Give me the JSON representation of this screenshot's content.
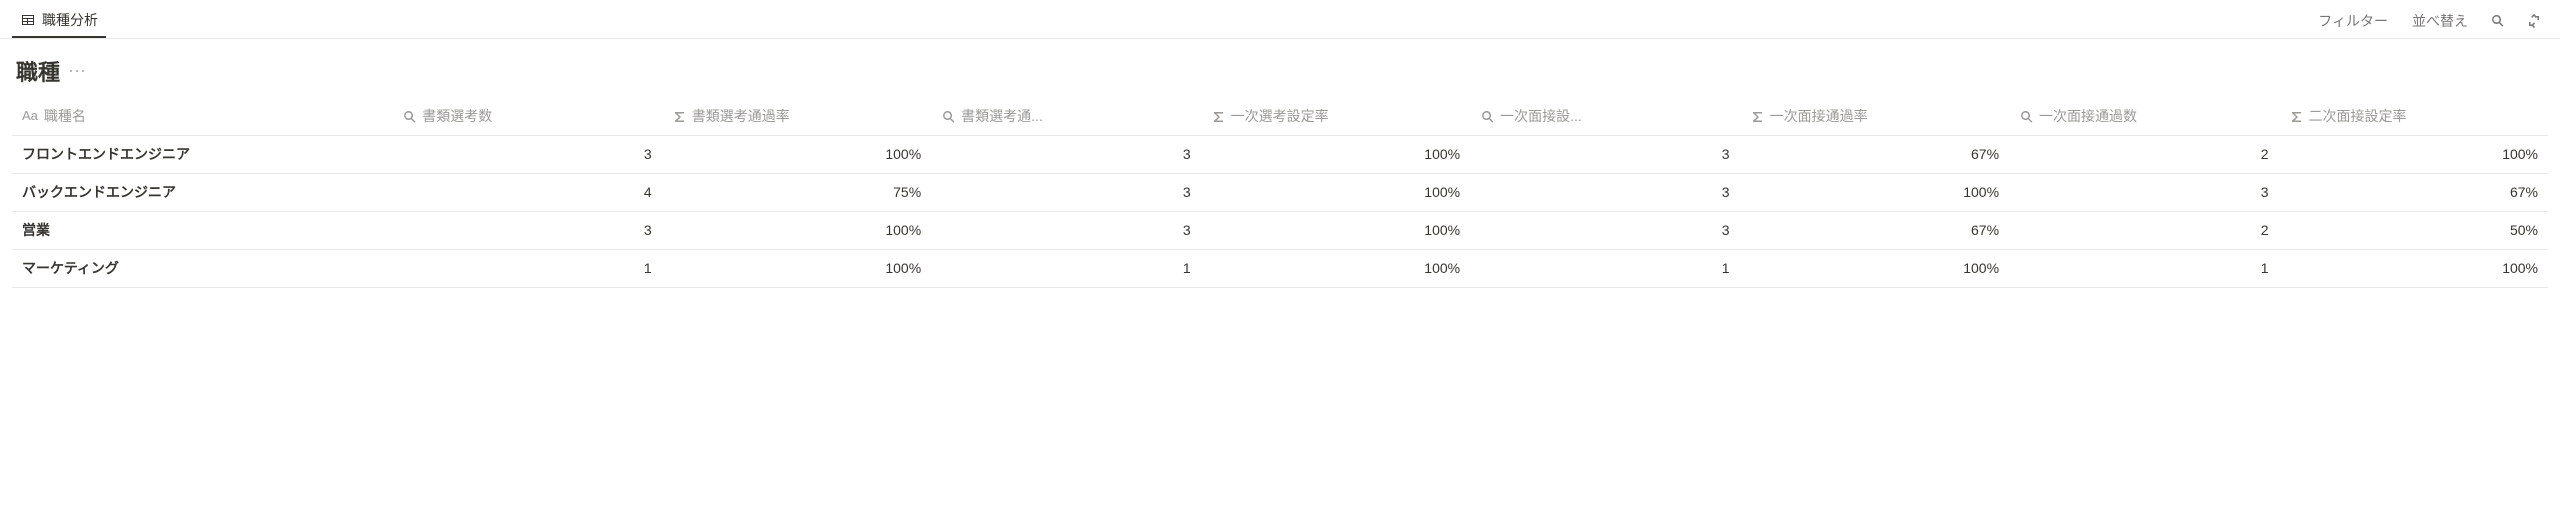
{
  "toolbar": {
    "tab_label": "職種分析",
    "filter_label": "フィルター",
    "sort_label": "並べ替え"
  },
  "title": "職種",
  "columns": [
    {
      "type": "title",
      "label": "職種名"
    },
    {
      "type": "rollup",
      "label": "書類選考数"
    },
    {
      "type": "formula",
      "label": "書類選考通過率"
    },
    {
      "type": "rollup",
      "label": "書類選考通..."
    },
    {
      "type": "formula",
      "label": "一次選考設定率"
    },
    {
      "type": "rollup",
      "label": "一次面接設..."
    },
    {
      "type": "formula",
      "label": "一次面接通過率"
    },
    {
      "type": "rollup",
      "label": "一次面接通過数"
    },
    {
      "type": "formula",
      "label": "二次面接設定率"
    }
  ],
  "rows": [
    {
      "name": "フロントエンドエンジニア",
      "values": [
        "3",
        "100%",
        "3",
        "100%",
        "3",
        "67%",
        "2",
        "100%"
      ]
    },
    {
      "name": "バックエンドエンジニア",
      "values": [
        "4",
        "75%",
        "3",
        "100%",
        "3",
        "100%",
        "3",
        "67%"
      ]
    },
    {
      "name": "営業",
      "values": [
        "3",
        "100%",
        "3",
        "100%",
        "3",
        "67%",
        "2",
        "50%"
      ]
    },
    {
      "name": "マーケティング",
      "values": [
        "1",
        "100%",
        "1",
        "100%",
        "1",
        "100%",
        "1",
        "100%"
      ]
    }
  ]
}
